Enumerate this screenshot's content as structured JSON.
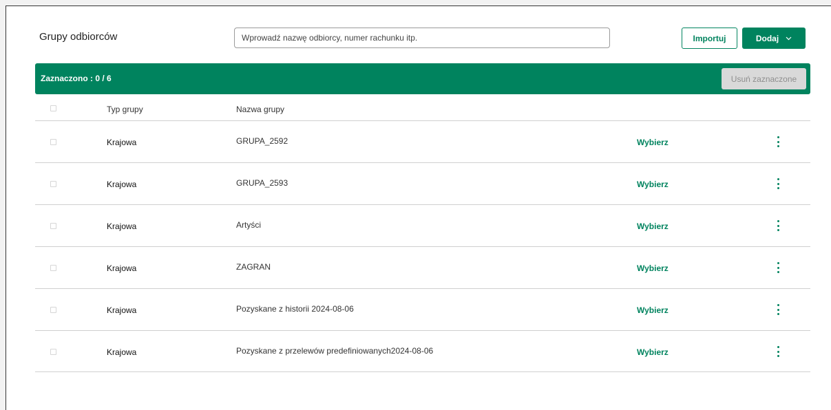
{
  "header": {
    "title": "Grupy odbiorców",
    "search_placeholder": "Wprowadź nazwę odbiorcy, numer rachunku itp.",
    "import_label": "Importuj",
    "add_label": "Dodaj"
  },
  "selection": {
    "label": "Zaznaczono : 0 / 6",
    "delete_label": "Usuń zaznaczone"
  },
  "table": {
    "columns": {
      "type": "Typ grupy",
      "name": "Nazwa grupy"
    },
    "rows": [
      {
        "type": "Krajowa",
        "name": "GRUPA_2592",
        "action": "Wybierz"
      },
      {
        "type": "Krajowa",
        "name": "GRUPA_2593",
        "action": "Wybierz"
      },
      {
        "type": "Krajowa",
        "name": "Artyści",
        "action": "Wybierz"
      },
      {
        "type": "Krajowa",
        "name": "ZAGRAN",
        "action": "Wybierz"
      },
      {
        "type": "Krajowa",
        "name": "Pozyskane z historii 2024-08-06",
        "action": "Wybierz"
      },
      {
        "type": "Krajowa",
        "name": "Pozyskane z przelewów predefiniowanych2024-08-06",
        "action": "Wybierz"
      }
    ]
  },
  "colors": {
    "accent": "#00835e",
    "disabled_bg": "#d9d9d9",
    "disabled_text": "#8e8e8e"
  },
  "icons": {
    "add_dropdown": "chevron-down-icon",
    "row_menu": "more-vertical-icon"
  }
}
